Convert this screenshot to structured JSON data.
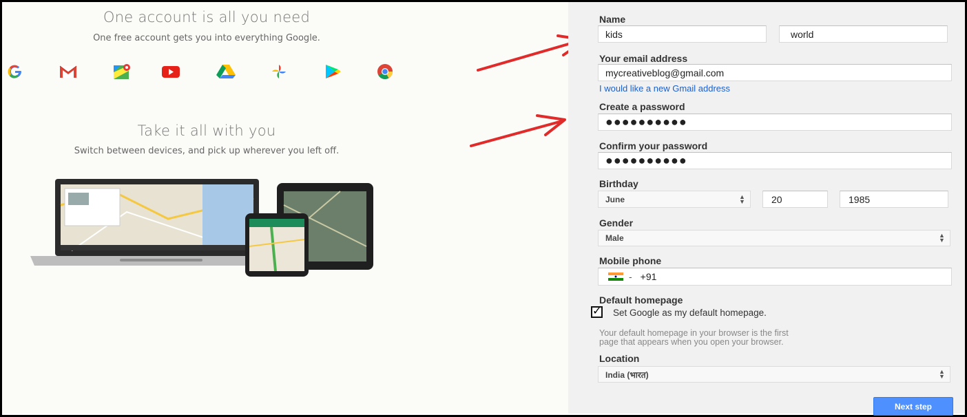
{
  "promo": {
    "heading1": "One account is all you need",
    "sub1": "One free account gets you into everything Google.",
    "heading2": "Take it all with you",
    "sub2": "Switch between devices, and pick up wherever you left off.",
    "product_icons": [
      "google-g-icon",
      "gmail-icon",
      "maps-icon",
      "youtube-icon",
      "drive-icon",
      "photos-icon",
      "play-store-icon",
      "chrome-icon"
    ]
  },
  "form": {
    "name_label": "Name",
    "first_name": "kids",
    "last_name": "world",
    "email_label": "Your email address",
    "email_value": "mycreativeblog@gmail.com",
    "new_gmail_link": "I would like a new Gmail address",
    "password_label": "Create a password",
    "password_mask": "●●●●●●●●●●",
    "confirm_label": "Confirm your password",
    "confirm_mask": "●●●●●●●●●●",
    "birthday_label": "Birthday",
    "birth_month": "June",
    "birth_day": "20",
    "birth_year": "1985",
    "gender_label": "Gender",
    "gender_value": "Male",
    "phone_label": "Mobile phone",
    "phone_code": "+91",
    "phone_flag_dash": "-",
    "homepage_label": "Default homepage",
    "homepage_checked": true,
    "homepage_check_label": "Set Google as my default homepage.",
    "homepage_hint_1": "Your default homepage in your browser is the first",
    "homepage_hint_2": "page that appears when you open your browser.",
    "location_label": "Location",
    "location_value": "India (भारत)",
    "next_button": "Next step",
    "stepper_glyph": "▲▼"
  },
  "colors": {
    "arrow": "#e02b2b",
    "primary_button": "#4d90fe",
    "link": "#1a5fcf"
  }
}
